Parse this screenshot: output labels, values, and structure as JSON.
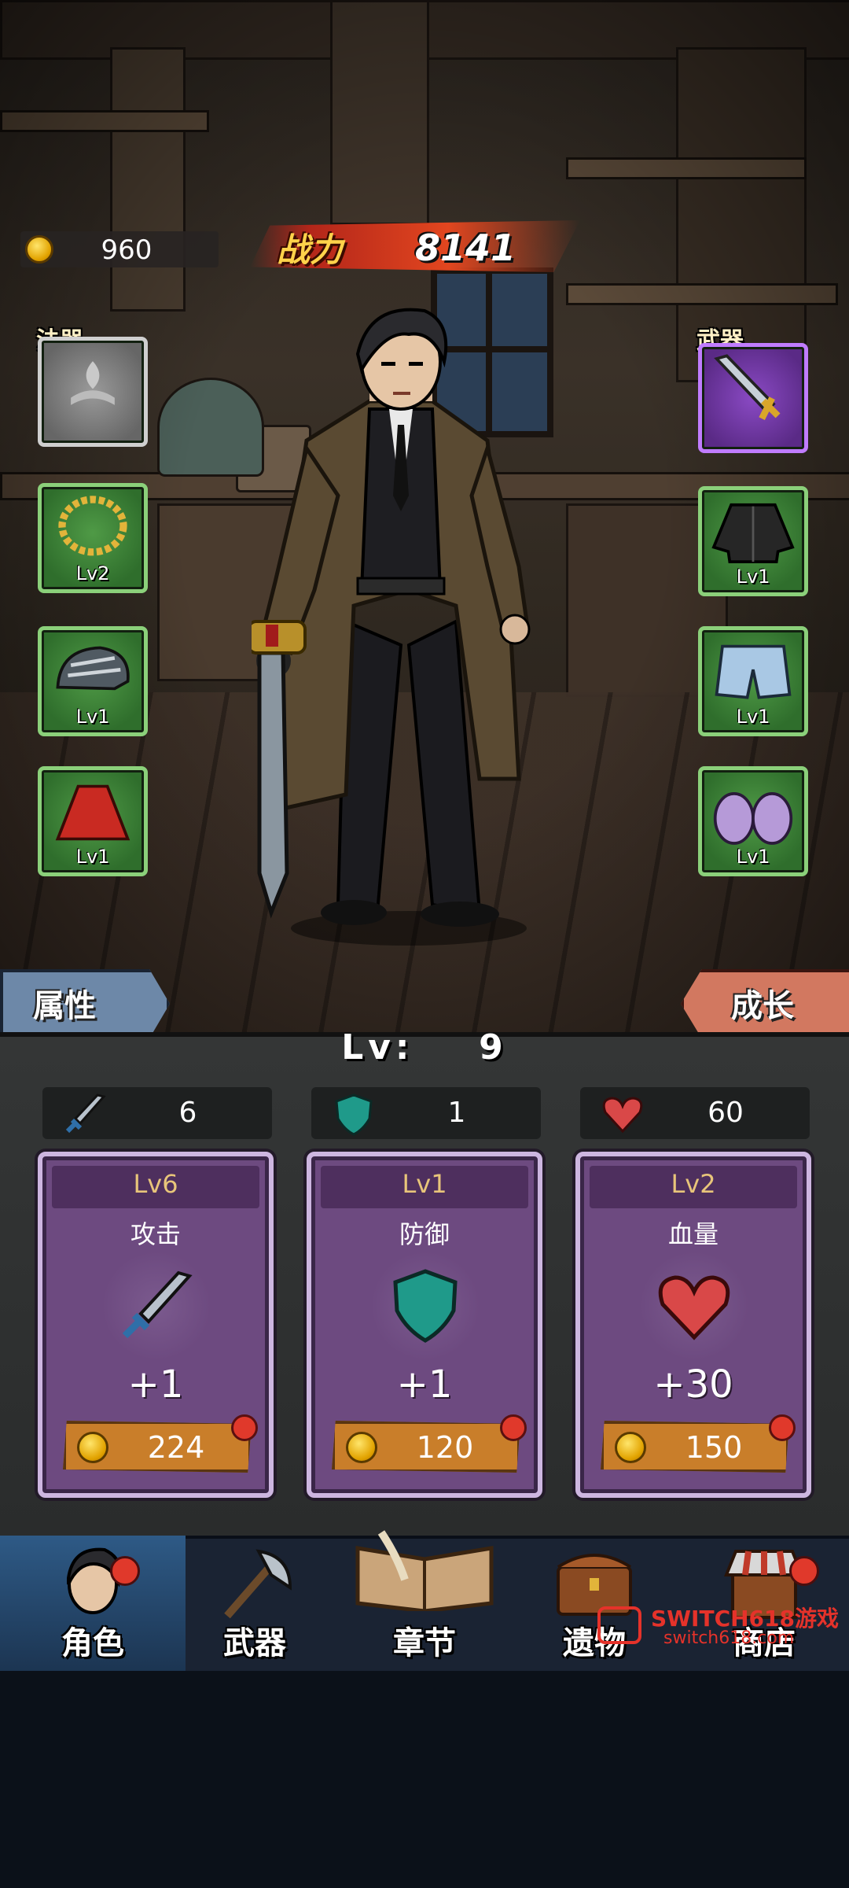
{
  "hud": {
    "gold": "960",
    "power_label": "战力",
    "power_value": "8141"
  },
  "equipment": {
    "left_label": "法器",
    "right_label": "武器",
    "left": [
      {
        "name": "artifact",
        "level": ""
      },
      {
        "name": "gold-chain",
        "level": "Lv2"
      },
      {
        "name": "helmet",
        "level": "Lv1"
      },
      {
        "name": "red-cape",
        "level": "Lv1"
      }
    ],
    "right": [
      {
        "name": "sword",
        "level": ""
      },
      {
        "name": "leather-jacket",
        "level": "Lv1"
      },
      {
        "name": "shorts",
        "level": "Lv1"
      },
      {
        "name": "clogs",
        "level": "Lv1"
      }
    ]
  },
  "tabs": {
    "left": "属性",
    "right": "成长"
  },
  "level": {
    "label": "Lv:",
    "value": "9"
  },
  "stats": {
    "attack": "6",
    "defense": "1",
    "hp": "60"
  },
  "upgrades": [
    {
      "level": "Lv6",
      "name": "攻击",
      "bonus": "+1",
      "cost": "224",
      "icon": "sword-icon",
      "color": "#9aa6b0"
    },
    {
      "level": "Lv1",
      "name": "防御",
      "bonus": "+1",
      "cost": "120",
      "icon": "shield-icon",
      "color": "#1f9a8a"
    },
    {
      "level": "Lv2",
      "name": "血量",
      "bonus": "+30",
      "cost": "150",
      "icon": "heart-icon",
      "color": "#d94848"
    }
  ],
  "nav": [
    {
      "label": "角色",
      "icon": "character-icon",
      "active": true,
      "badge": true
    },
    {
      "label": "武器",
      "icon": "axe-icon",
      "active": false,
      "badge": false
    },
    {
      "label": "章节",
      "icon": "book-icon",
      "active": false,
      "badge": false
    },
    {
      "label": "遗物",
      "icon": "chest-icon",
      "active": false,
      "badge": false
    },
    {
      "label": "商店",
      "icon": "shop-icon",
      "active": false,
      "badge": true
    }
  ],
  "watermark": {
    "title": "SWITCH618游戏",
    "url": "switch618.com"
  },
  "colors": {
    "badge": "#e0392b",
    "card_bg": "#6d4a80",
    "buy_button": "#c97e2a",
    "slot_green": "#4f9a46",
    "slot_purple": "#8a4ac4"
  }
}
